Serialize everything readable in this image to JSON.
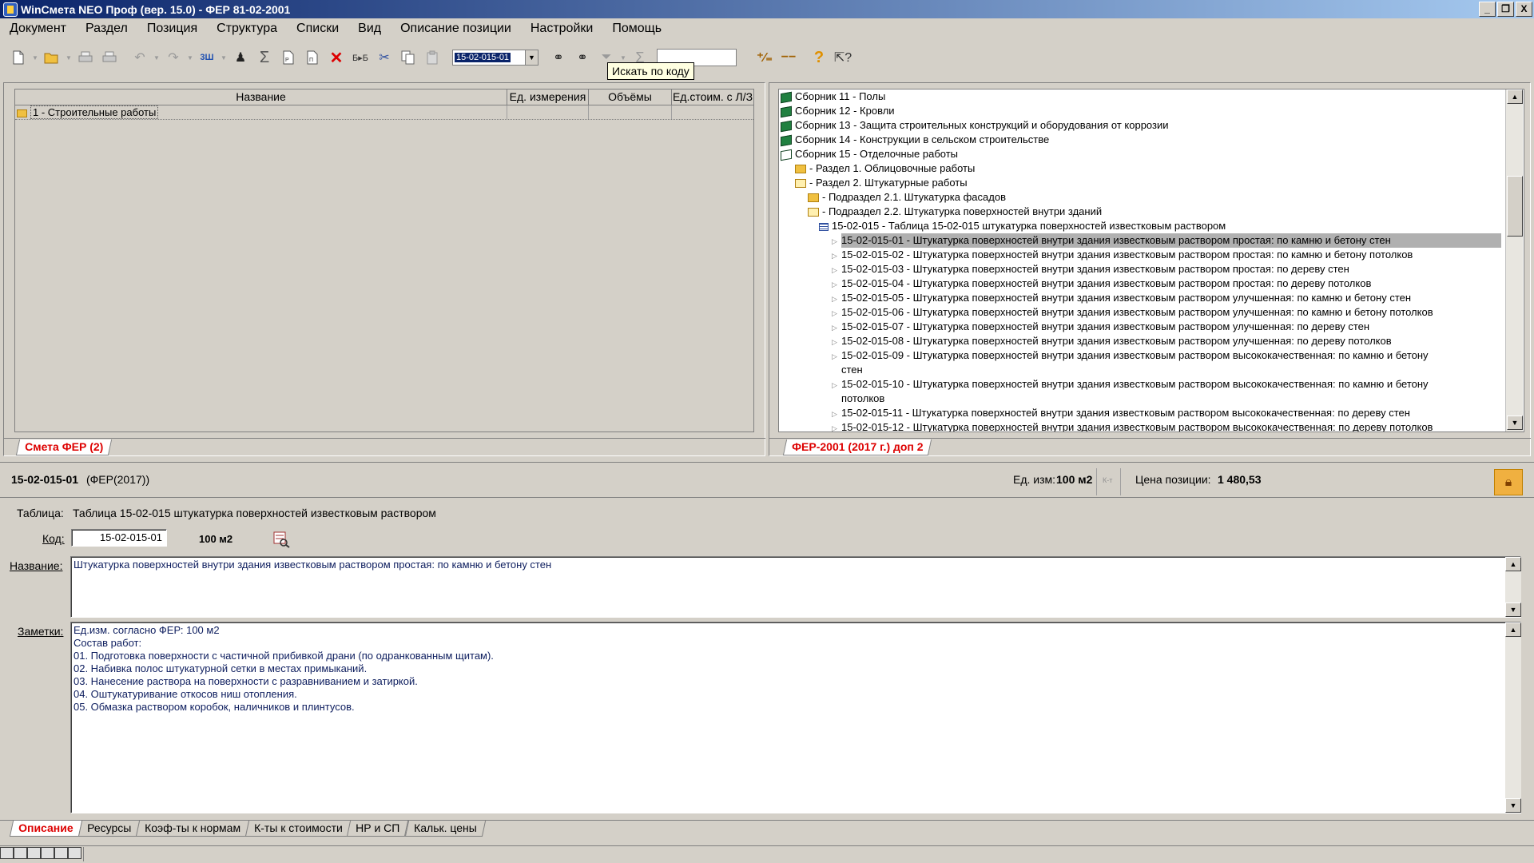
{
  "window": {
    "title": "WinСмета NEO Проф (вер. 15.0) - ФЕР 81-02-2001",
    "min": "_",
    "max": "❐",
    "close": "X"
  },
  "menu": [
    "Документ",
    "Раздел",
    "Позиция",
    "Структура",
    "Списки",
    "Вид",
    "Описание позиции",
    "Настройки",
    "Помощь"
  ],
  "toolbar": {
    "code_value": "15-02-015-01",
    "tooltip": "Искать по коду",
    "search_value": ""
  },
  "estimate": {
    "columns": [
      "Название",
      "Ед. измерения",
      "Объёмы",
      "Ед.стоим. с Л/З"
    ],
    "rows": [
      {
        "name": "1 - Строительные работы",
        "unit": "",
        "volume": "",
        "cost": ""
      }
    ],
    "tab": "Смета ФЕР (2)"
  },
  "catalog": {
    "tab": "ФЕР-2001 (2017 г.) доп 2",
    "nodes": [
      {
        "text": "Сборник 11 - Полы",
        "type": "book"
      },
      {
        "text": "Сборник 12 - Кровли",
        "type": "book"
      },
      {
        "text": "Сборник 13 - Защита строительных конструкций и оборудования от коррозии",
        "type": "book"
      },
      {
        "text": "Сборник 14 - Конструкции в сельском строительстве",
        "type": "book"
      },
      {
        "text": "Сборник 15 - Отделочные работы",
        "type": "book-open"
      },
      {
        "text": "- Раздел 1. Облицовочные работы",
        "type": "folder"
      },
      {
        "text": "- Раздел 2. Штукатурные работы",
        "type": "folder-open"
      },
      {
        "text": "- Подраздел 2.1. Штукатурка фасадов",
        "type": "folder"
      },
      {
        "text": "- Подраздел 2.2. Штукатурка поверхностей внутри зданий",
        "type": "folder-open"
      },
      {
        "text": "15-02-015 - Таблица 15-02-015 штукатурка поверхностей известковым раствором",
        "type": "table"
      },
      {
        "text": "15-02-015-01 - Штукатурка поверхностей внутри здания известковым раствором простая: по камню и бетону стен",
        "type": "item",
        "selected": true
      },
      {
        "text": "15-02-015-02 - Штукатурка поверхностей внутри здания известковым раствором простая: по камню и бетону потолков",
        "type": "item"
      },
      {
        "text": "15-02-015-03 - Штукатурка поверхностей внутри здания известковым раствором простая: по дереву стен",
        "type": "item"
      },
      {
        "text": "15-02-015-04 - Штукатурка поверхностей внутри здания известковым раствором простая: по дереву потолков",
        "type": "item"
      },
      {
        "text": "15-02-015-05 - Штукатурка поверхностей внутри здания известковым раствором улучшенная: по камню и бетону стен",
        "type": "item"
      },
      {
        "text": "15-02-015-06 - Штукатурка поверхностей внутри здания известковым раствором улучшенная: по камню и бетону потолков",
        "type": "item"
      },
      {
        "text": "15-02-015-07 - Штукатурка поверхностей внутри здания известковым раствором улучшенная: по дереву стен",
        "type": "item"
      },
      {
        "text": "15-02-015-08 - Штукатурка поверхностей внутри здания известковым раствором улучшенная: по дереву потолков",
        "type": "item"
      },
      {
        "text": "15-02-015-09 - Штукатурка поверхностей внутри здания известковым раствором высококачественная: по камню и бетону",
        "cont": "стен",
        "type": "item"
      },
      {
        "text": "15-02-015-10 - Штукатурка поверхностей внутри здания известковым раствором высококачественная: по камню и бетону",
        "cont": "потолков",
        "type": "item"
      },
      {
        "text": "15-02-015-11 - Штукатурка поверхностей внутри здания известковым раствором высококачественная: по дереву стен",
        "type": "item"
      },
      {
        "text": "15-02-015-12 - Штукатурка поверхностей внутри здания известковым раствором высококачественная: по дереву потолков",
        "type": "item"
      }
    ]
  },
  "position": {
    "code": "15-02-015-01",
    "norm": "(ФЕР(2017))",
    "unit_label": "Ед. изм:",
    "unit": "100 м2",
    "kt_label": "К-т",
    "price_label": "Цена позиции:",
    "price": "1 480,53",
    "table_label": "Таблица:",
    "table_value": "Таблица 15-02-015 штукатурка поверхностей известковым раствором",
    "code_label": "Код:",
    "code_field": "15-02-015-01",
    "code_unit": "100 м2",
    "name_label": "Название:",
    "name_value": "Штукатурка поверхностей внутри здания известковым раствором простая: по камню и бетону стен",
    "notes_label": "Заметки:",
    "notes": [
      "Ед.изм. согласно ФЕР: 100 м2",
      "Состав работ:",
      "01. Подготовка поверхности с частичной прибивкой драни (по одранкованным щитам).",
      "02. Набивка полос штукатурной сетки в местах примыканий.",
      "03. Нанесение раствора на поверхности с разравниванием и затиркой.",
      "04. Оштукатуривание откосов ниш отопления.",
      "05. Обмазка раствором коробок, наличников и плинтусов."
    ]
  },
  "bottom_tabs": [
    "Описание",
    "Ресурсы",
    "Коэф-ты к нормам",
    "К-ты к стоимости",
    "НР и СП",
    "Кальк. цены"
  ]
}
